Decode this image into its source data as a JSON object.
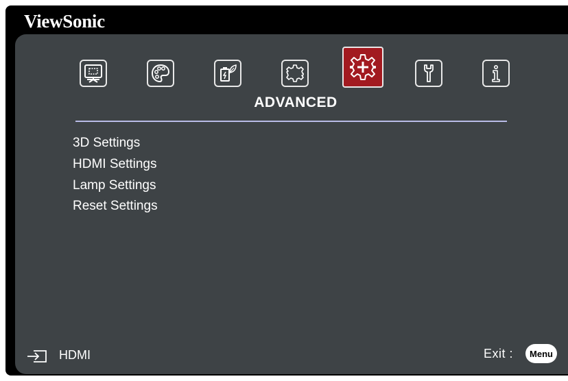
{
  "brand": "ViewSonic",
  "tabs": [
    {
      "icon": "display-icon",
      "active": false
    },
    {
      "icon": "palette-icon",
      "active": false
    },
    {
      "icon": "power-eco-icon",
      "active": false
    },
    {
      "icon": "gear-icon",
      "active": false
    },
    {
      "icon": "advanced-gear-icon",
      "active": true
    },
    {
      "icon": "wrench-icon",
      "active": false
    },
    {
      "icon": "info-icon",
      "active": false
    }
  ],
  "active_tab_title": "ADVANCED",
  "menu_items": [
    "3D Settings",
    "HDMI Settings",
    "Lamp Settings",
    "Reset Settings"
  ],
  "footer": {
    "input_icon": "input-source-icon",
    "input_label": "HDMI",
    "exit_label": "Exit :",
    "exit_key": "Menu"
  },
  "colors": {
    "panel": "#3e4346",
    "active_tab": "#a21a20",
    "divider": "#b9bce8",
    "text": "#ffffff"
  }
}
